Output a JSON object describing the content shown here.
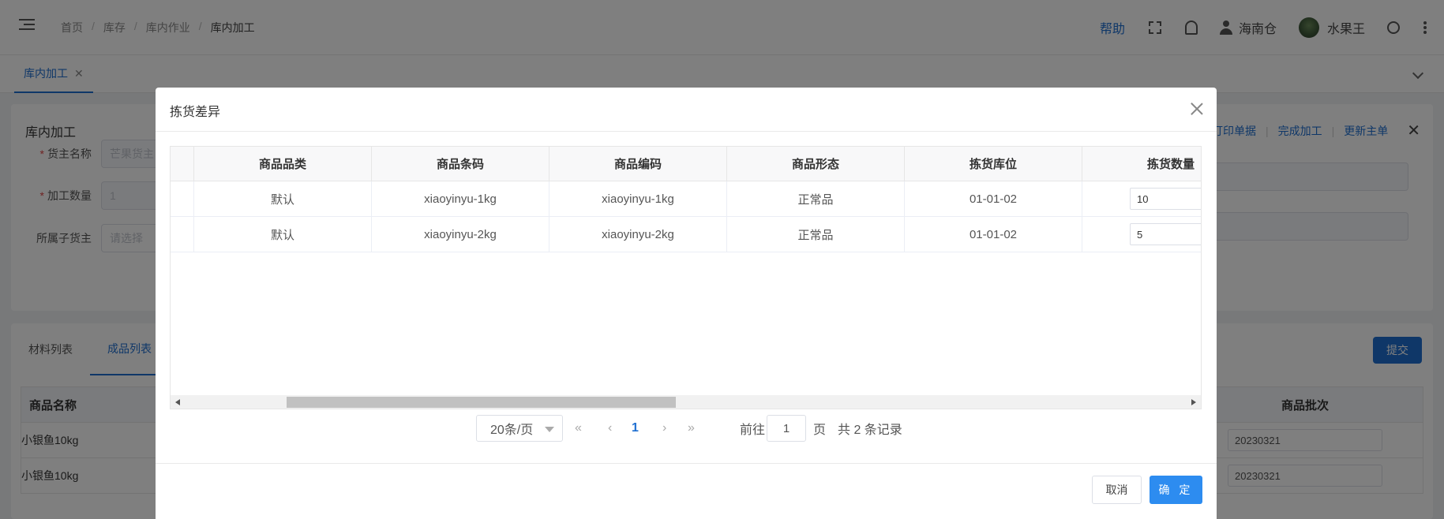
{
  "header": {
    "breadcrumb": [
      "首页",
      "库存",
      "库内作业",
      "库内加工"
    ],
    "help": "帮助",
    "warehouse": "海南仓",
    "username": "水果王"
  },
  "tabs": {
    "active_tab": "库内加工",
    "close": "✕"
  },
  "card": {
    "title": "库内加工",
    "actions": [
      "打印单据",
      "完成加工",
      "更新主单"
    ],
    "close": "✕",
    "fields": [
      {
        "label": "货主名称",
        "required": true,
        "value": "",
        "placeholder": "芒果货主"
      },
      {
        "label": "加工数量",
        "required": true,
        "value": "1",
        "placeholder": ""
      },
      {
        "label": "所属子货主",
        "required": false,
        "value": "",
        "placeholder": "请选择"
      }
    ]
  },
  "list_section": {
    "tabs": [
      "材料列表",
      "成品列表"
    ],
    "active_tab": 1,
    "submit": "提交",
    "columns": {
      "name": "商品名称",
      "batch": "商品批次"
    },
    "rows": [
      {
        "name": "小银鱼10kg",
        "batch": "20230321"
      },
      {
        "name": "小银鱼10kg",
        "batch": "20230321"
      }
    ]
  },
  "modal": {
    "title": "拣货差异",
    "columns": [
      "商品品类",
      "商品条码",
      "商品编码",
      "商品形态",
      "拣货库位",
      "拣货数量"
    ],
    "rows": [
      {
        "category": "默认",
        "barcode": "xiaoyinyu-1kg",
        "code": "xiaoyinyu-1kg",
        "form": "正常品",
        "location": "01-01-02",
        "qty": "10"
      },
      {
        "category": "默认",
        "barcode": "xiaoyinyu-2kg",
        "code": "xiaoyinyu-2kg",
        "form": "正常品",
        "location": "01-01-02",
        "qty": "5"
      }
    ],
    "pagination": {
      "page_size": "20条/页",
      "current_page": "1",
      "goto_prefix": "前往",
      "goto_value": "1",
      "goto_suffix": "页",
      "total": "共 2 条记录"
    },
    "buttons": {
      "cancel": "取消",
      "confirm": "确 定"
    }
  }
}
